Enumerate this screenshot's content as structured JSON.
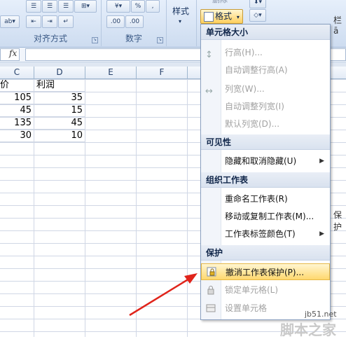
{
  "ribbon": {
    "alignment_group": "对齐方式",
    "number_group": "数字",
    "number_format_percent": "%",
    "number_format_comma": ",",
    "decimal_increase": ".00",
    "decimal_decrease": ".00",
    "styles_label": "样式",
    "delete_label": "删除",
    "format_button": "格式"
  },
  "formula_bar": {
    "fx": "fx"
  },
  "columns": [
    "C",
    "D",
    "E",
    "F"
  ],
  "cells": [
    [
      "价",
      "利润"
    ],
    [
      "105",
      "35"
    ],
    [
      "45",
      "15"
    ],
    [
      "135",
      "45"
    ],
    [
      "30",
      "10"
    ]
  ],
  "menu": {
    "cell_size_header": "单元格大小",
    "row_height": "行高(H)...",
    "autofit_row_height": "自动调整行高(A)",
    "column_width": "列宽(W)...",
    "autofit_column_width": "自动调整列宽(I)",
    "default_width": "默认列宽(D)...",
    "visibility_header": "可见性",
    "hide_unhide": "隐藏和取消隐藏(U)",
    "organize_header": "组织工作表",
    "rename_sheet": "重命名工作表(R)",
    "move_copy_sheet": "移动或复制工作表(M)...",
    "tab_color": "工作表标签颜色(T)",
    "protection_header": "保护",
    "unprotect_sheet": "撤消工作表保护(P)...",
    "lock_cell": "锁定单元格(L)",
    "format_cells": "设置单元格"
  },
  "right_edge": {
    "partial_a": "栏ā",
    "partial_b": "保护"
  },
  "watermark": {
    "site": "jb51.net",
    "brand": "脚本之家"
  },
  "colors": {
    "arrow": "#e0241b",
    "highlight": "#ffd86e"
  }
}
